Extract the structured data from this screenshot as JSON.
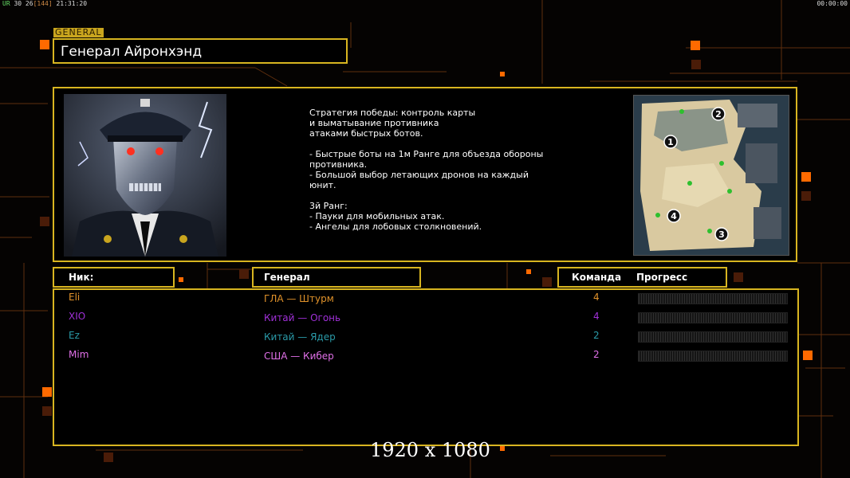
{
  "hud": {
    "ur_label": "UR",
    "stats": "30 26",
    "bracket": "[144]",
    "clock": "21:31:20",
    "timer": "00:00:00"
  },
  "general": {
    "tag": "GENERAL",
    "title": "Генерал Айронхэнд",
    "description": "Стратегия победы: контроль карты\nи выматывание противника\nатаками быстрых ботов.\n\n- Быстрые боты на 1м Ранге для объезда обороны\n  противника.\n- Большой выбор летающих дронов на каждый\n  юнит.\n\n3й Ранг:\n- Пауки для мобильных атак.\n- Ангелы для лобовых столкновений.",
    "portrait_icon": "general-portrait-cyborg",
    "map_icon": "minimap",
    "map_markers": [
      "1",
      "2",
      "3",
      "4"
    ]
  },
  "table": {
    "headers": {
      "nick": "Ник:",
      "general": "Генерал",
      "team": "Команда",
      "progress": "Прогресс"
    },
    "rows": [
      {
        "nick": "Eli",
        "general": "ГЛА — Штурм",
        "team": "4",
        "color": "#e0922a",
        "progress": 0
      },
      {
        "nick": "XIO",
        "general": "Китай — Огонь",
        "team": "4",
        "color": "#a030d8",
        "progress": 0
      },
      {
        "nick": "Ez",
        "general": "Китай — Ядер",
        "team": "2",
        "color": "#2a9aa8",
        "progress": 0
      },
      {
        "nick": "Mim",
        "general": "США — Кибер",
        "team": "2",
        "color": "#e070e8",
        "progress": 0
      }
    ]
  },
  "resolution": "1920 x 1080",
  "colors": {
    "accent": "#d8b520",
    "orange": "#ff6a00",
    "background": "#050302"
  }
}
